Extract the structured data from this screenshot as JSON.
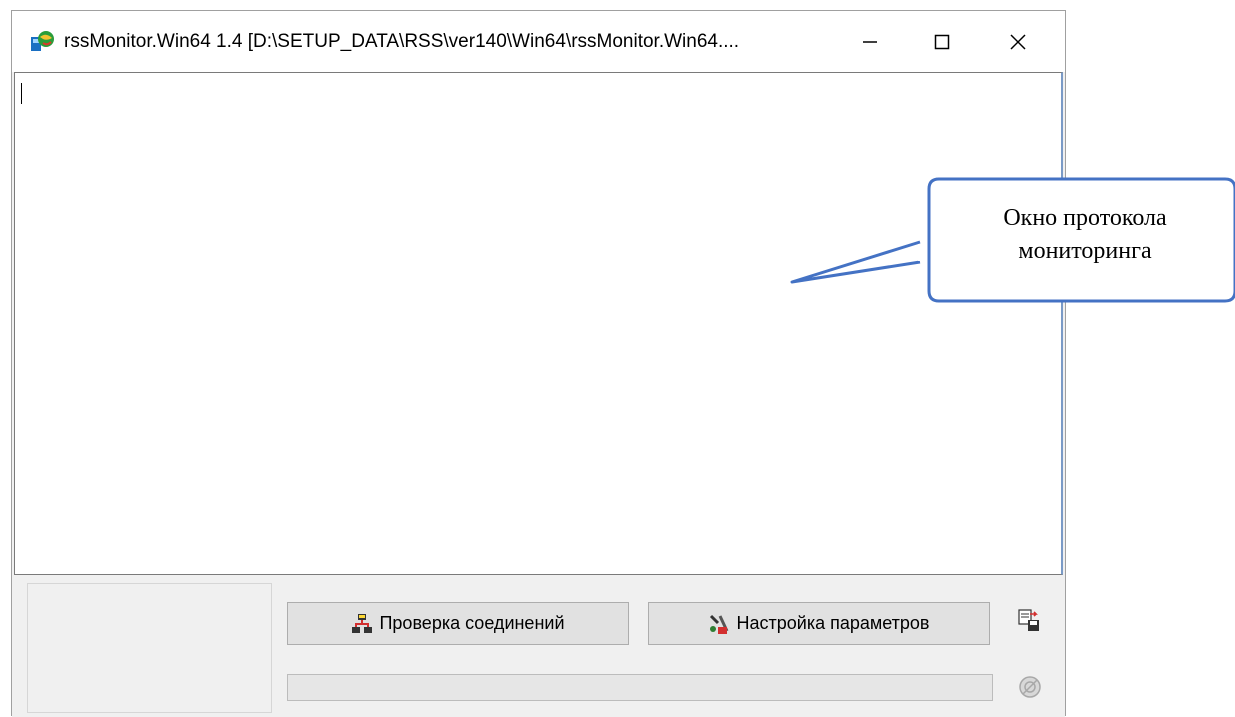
{
  "window": {
    "title": "rssMonitor.Win64 1.4 [D:\\SETUP_DATA\\RSS\\ver140\\Win64\\rssMonitor.Win64....",
    "icon": "app-globe-icon",
    "controls": {
      "minimize": "minimize-icon",
      "maximize": "maximize-icon",
      "close": "close-icon"
    }
  },
  "buttons": {
    "check_connections": {
      "label": "Проверка соединений",
      "icon": "network-icon"
    },
    "settings": {
      "label": "Настройка параметров",
      "icon": "tools-icon"
    },
    "save_log": {
      "icon": "save-log-icon"
    },
    "disabled_action": {
      "icon": "disabled-circle-icon"
    }
  },
  "progress": {
    "value": 0
  },
  "callout": {
    "line1": "Окно протокола",
    "line2": "мониторинга"
  },
  "colors": {
    "callout_border": "#4472c4",
    "window_bg": "#f0f0f0",
    "button_bg": "#e1e1e1"
  }
}
